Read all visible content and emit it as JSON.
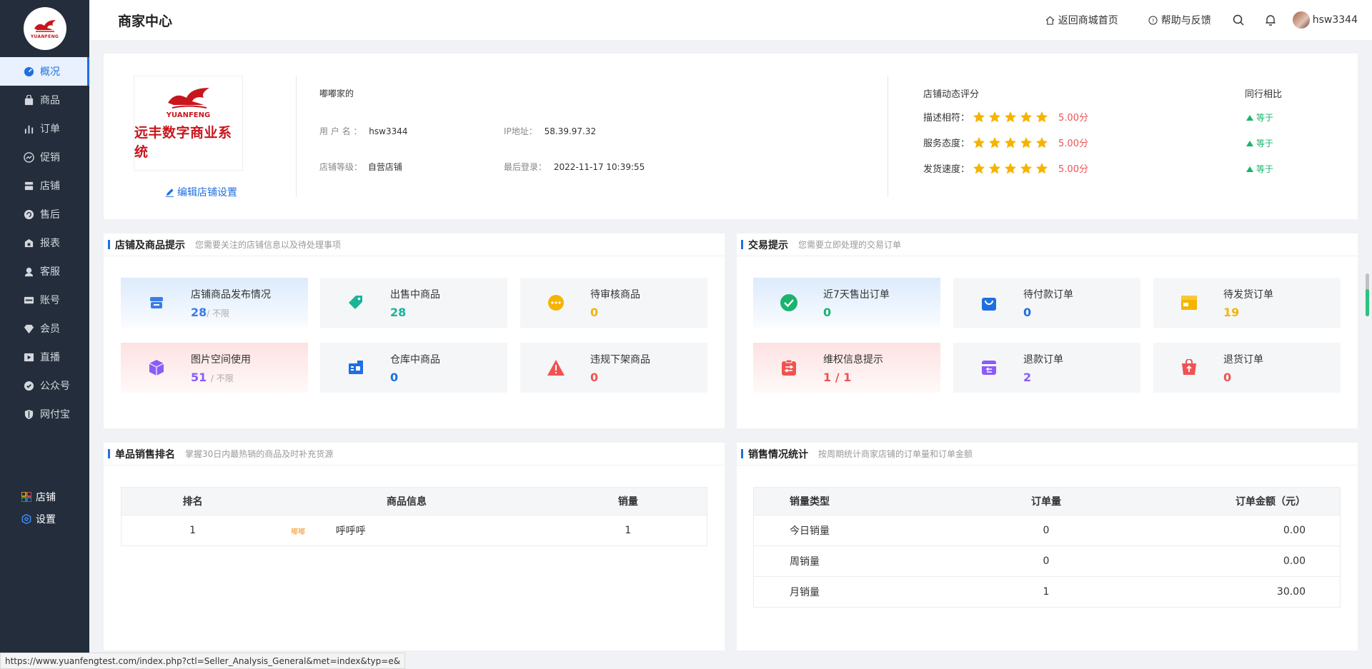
{
  "sidebar": {
    "logo_text": "YUANFENG",
    "items": [
      {
        "label": "概况",
        "icon": "dashboard-icon"
      },
      {
        "label": "商品",
        "icon": "bag-icon"
      },
      {
        "label": "订单",
        "icon": "bar-chart-icon"
      },
      {
        "label": "促销",
        "icon": "promotion-icon"
      },
      {
        "label": "店铺",
        "icon": "store-icon"
      },
      {
        "label": "售后",
        "icon": "aftersale-icon"
      },
      {
        "label": "报表",
        "icon": "report-icon"
      },
      {
        "label": "客服",
        "icon": "customer-service-icon"
      },
      {
        "label": "账号",
        "icon": "account-icon"
      },
      {
        "label": "会员",
        "icon": "diamond-icon"
      },
      {
        "label": "直播",
        "icon": "live-icon"
      },
      {
        "label": "公众号",
        "icon": "official-account-icon"
      },
      {
        "label": "网付宝",
        "icon": "shield-icon"
      }
    ],
    "bottom": [
      {
        "label": "店铺",
        "icon": "grid-icon"
      },
      {
        "label": "设置",
        "icon": "settings-icon"
      }
    ]
  },
  "header": {
    "title": "商家中心",
    "back_home": "返回商城首页",
    "help": "帮助与反馈",
    "username": "hsw3344"
  },
  "profile": {
    "logo_en": "YUANFENG",
    "logo_cn": "远丰数字商业系统",
    "edit_label": "编辑店铺设置",
    "shop_name": "嘟嘟家的",
    "username_label": "用 户 名 ：",
    "username": "hsw3344",
    "ip_label": "IP地址：",
    "ip": "58.39.97.32",
    "level_label": "店铺等级：",
    "level": "自营店铺",
    "last_login_label": "最后登录：",
    "last_login": "2022-11-17 10:39:55",
    "rating_title": "店铺动态评分",
    "compare_title": "同行相比",
    "ratings": [
      {
        "label": "描述相符：",
        "stars": 5,
        "score": "5.00分",
        "compare": "等于"
      },
      {
        "label": "服务态度：",
        "stars": 5,
        "score": "5.00分",
        "compare": "等于"
      },
      {
        "label": "发货速度：",
        "stars": 5,
        "score": "5.00分",
        "compare": "等于"
      }
    ]
  },
  "shop_tips": {
    "title": "店铺及商品提示",
    "desc": "您需要关注的店铺信息以及待处理事项",
    "cards": [
      {
        "title": "店铺商品发布情况",
        "value": "28",
        "sub": "/ 不限",
        "color": "#3b7be8",
        "icon": "store-box-icon"
      },
      {
        "title": "出售中商品",
        "value": "28",
        "sub": "",
        "color": "#19b497",
        "icon": "tag-icon"
      },
      {
        "title": "待审核商品",
        "value": "0",
        "sub": "",
        "color": "#f5b400",
        "icon": "pending-icon"
      },
      {
        "title": "图片空间使用",
        "value": "51",
        "sub": "/ 不限",
        "color": "#8b5cf6",
        "icon": "cube-icon"
      },
      {
        "title": "仓库中商品",
        "value": "0",
        "sub": "",
        "color": "#1f6fe0",
        "icon": "warehouse-icon"
      },
      {
        "title": "违规下架商品",
        "value": "0",
        "sub": "",
        "color": "#f05252",
        "icon": "warning-icon"
      }
    ]
  },
  "trade_tips": {
    "title": "交易提示",
    "desc": "您需要立即处理的交易订单",
    "cards": [
      {
        "title": "近7天售出订单",
        "value": "0",
        "color": "#19b46e",
        "icon": "check-circle-icon"
      },
      {
        "title": "待付款订单",
        "value": "0",
        "color": "#1f6fe0",
        "icon": "shopping-bag-icon"
      },
      {
        "title": "待发货订单",
        "value": "19",
        "color": "#f5b400",
        "icon": "package-icon"
      },
      {
        "title": "维权信息提示",
        "value": "1 / 1",
        "color": "#f05252",
        "icon": "clipboard-icon"
      },
      {
        "title": "退款订单",
        "value": "2",
        "color": "#8b5cf6",
        "icon": "refund-icon"
      },
      {
        "title": "退货订单",
        "value": "0",
        "color": "#f05252",
        "icon": "return-cart-icon"
      }
    ]
  },
  "ranking": {
    "title": "单品销售排名",
    "desc": "掌握30日内最热销的商品及时补充货源",
    "headers": [
      "排名",
      "商品信息",
      "销量"
    ],
    "rows": [
      {
        "rank": "1",
        "thumb": "嘟嘟",
        "name": "呼呼呼",
        "sales": "1"
      }
    ]
  },
  "sales": {
    "title": "销售情况统计",
    "desc": "按周期统计商家店铺的订单量和订单金额",
    "headers": [
      "销量类型",
      "订单量",
      "订单金额（元）"
    ],
    "rows": [
      {
        "type": "今日销量",
        "orders": "0",
        "amount": "0.00"
      },
      {
        "type": "周销量",
        "orders": "0",
        "amount": "0.00"
      },
      {
        "type": "月销量",
        "orders": "1",
        "amount": "30.00"
      }
    ]
  },
  "status_url": "https://www.yuanfengtest.com/index.php?ctl=Seller_Analysis_General&met=index&typ=e&"
}
